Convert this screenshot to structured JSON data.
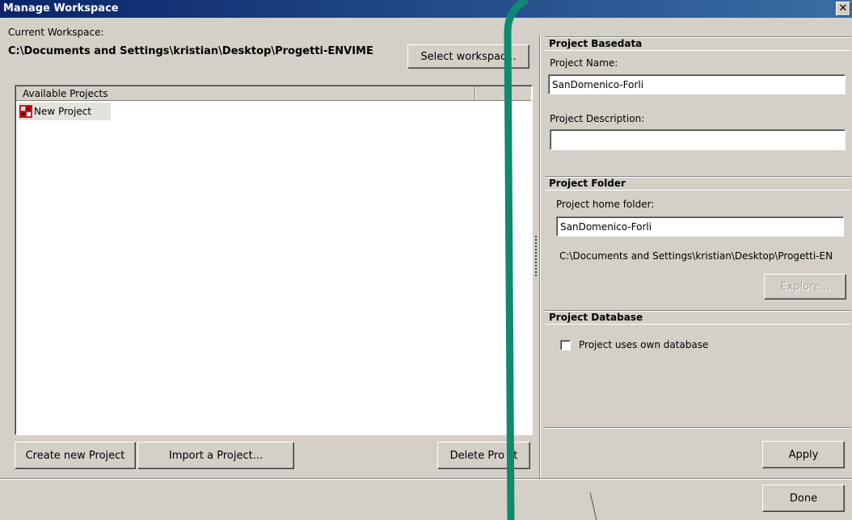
{
  "window": {
    "title": "Manage Workspace",
    "close_glyph": "✕"
  },
  "workspace": {
    "label": "Current Workspace:",
    "path": "C:\\Documents and Settings\\kristian\\Desktop\\Progetti-ENVIME",
    "select_button": "Select workspac..."
  },
  "projects": {
    "header": "Available Projects",
    "items": [
      {
        "label": "New Project",
        "icon": "project-icon"
      }
    ]
  },
  "buttons": {
    "create": "Create new Project",
    "import": "Import a Project...",
    "delete": "Delete Pro ct",
    "apply": "Apply",
    "done": "Done",
    "explore": "Explore..."
  },
  "basedata": {
    "header": "Project Basedata",
    "name_label": "Project Name:",
    "name_value": "SanDomenico-Forli",
    "desc_label": "Project Description:",
    "desc_value": ""
  },
  "folder": {
    "header": "Project Folder",
    "home_label": "Project home folder:",
    "home_value": "SanDomenico-Forli",
    "path_text": "C:\\Documents and Settings\\kristian\\Desktop\\Progetti-EN"
  },
  "database": {
    "header": "Project Database",
    "own_db_label": "Project uses own database",
    "own_db_checked": false
  },
  "colors": {
    "overlay_stroke": "#0e8a6e",
    "title_bar": "#0a246a"
  }
}
